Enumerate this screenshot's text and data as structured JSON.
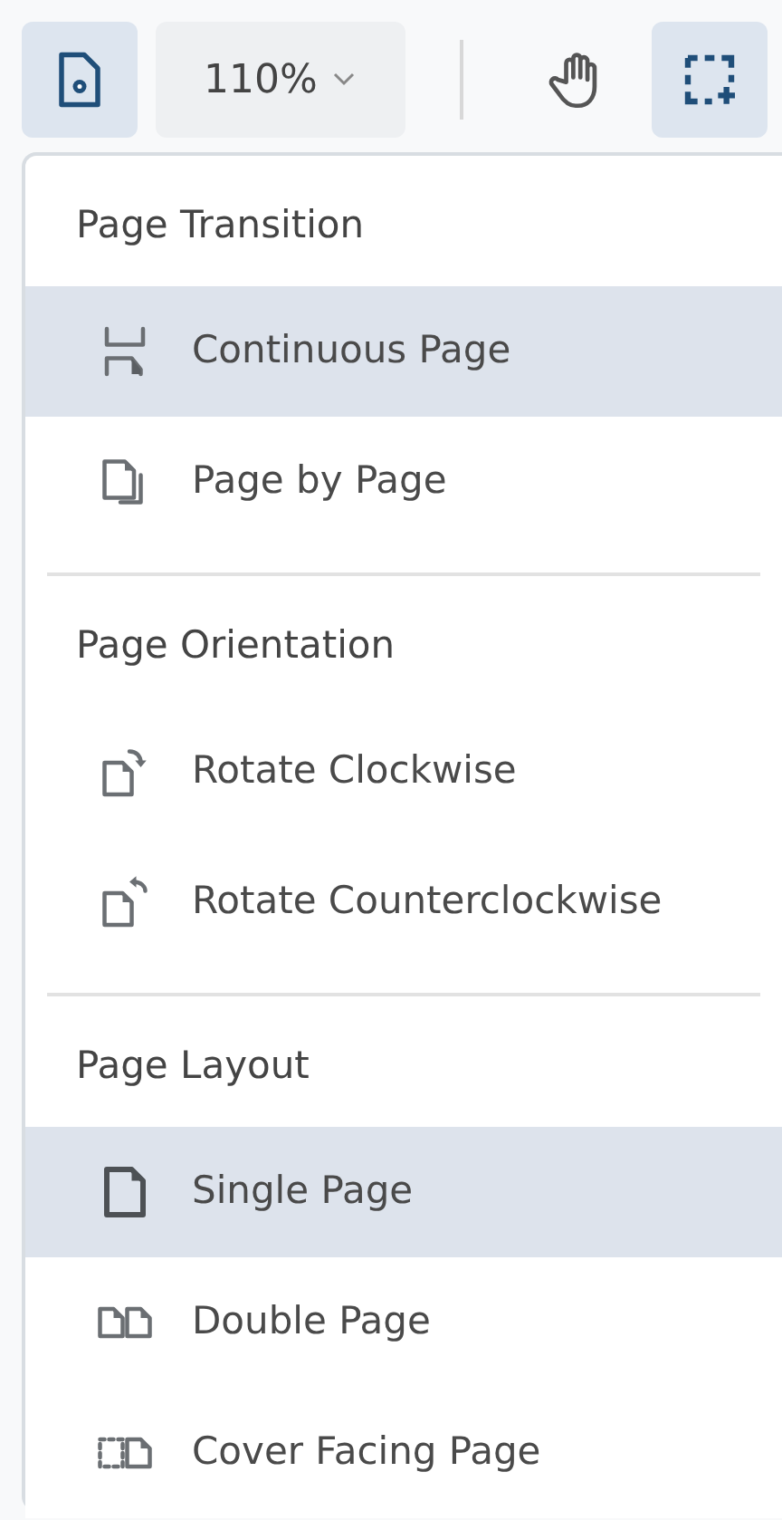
{
  "toolbar": {
    "document_settings": {
      "selected": true
    },
    "zoom": {
      "value": "110%"
    },
    "pan_tool": {
      "selected": false
    },
    "area_select": {
      "selected": true
    }
  },
  "menu": {
    "sections": [
      {
        "heading": "Page Transition",
        "items": [
          {
            "kind": "continuous",
            "label": "Continuous Page",
            "selected": true
          },
          {
            "kind": "page-by-page",
            "label": "Page by Page",
            "selected": false
          }
        ]
      },
      {
        "heading": "Page Orientation",
        "items": [
          {
            "kind": "rotate-cw",
            "label": "Rotate Clockwise",
            "selected": false
          },
          {
            "kind": "rotate-ccw",
            "label": "Rotate Counterclockwise",
            "selected": false
          }
        ]
      },
      {
        "heading": "Page Layout",
        "items": [
          {
            "kind": "single",
            "label": "Single Page",
            "selected": true
          },
          {
            "kind": "double",
            "label": "Double Page",
            "selected": false
          },
          {
            "kind": "cover",
            "label": "Cover Facing Page",
            "selected": false
          }
        ]
      }
    ]
  }
}
